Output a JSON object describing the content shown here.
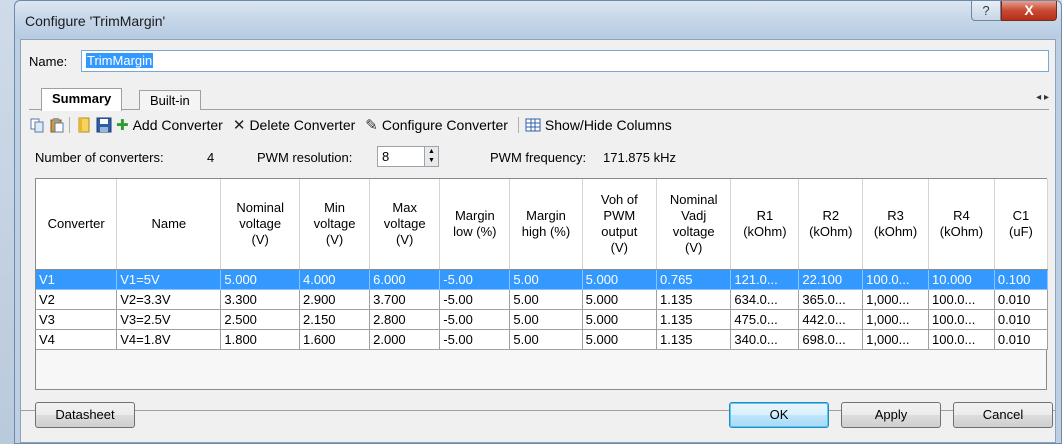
{
  "window": {
    "title": "Configure 'TrimMargin'",
    "help_glyph": "?",
    "close_glyph": "X"
  },
  "name_field": {
    "label": "Name:",
    "value": "TrimMargin"
  },
  "tabs": [
    {
      "label": "Summary",
      "active": true
    },
    {
      "label": "Built-in",
      "active": false
    }
  ],
  "tab_scroll": "◂ ▸",
  "toolbar": {
    "add_converter": "Add Converter",
    "delete_converter": "Delete Converter",
    "configure_converter": "Configure Converter",
    "show_hide_columns": "Show/Hide Columns"
  },
  "info": {
    "num_converters_label": "Number of converters:",
    "num_converters_value": "4",
    "pwm_resolution_label": "PWM resolution:",
    "pwm_resolution_value": "8",
    "pwm_frequency_label": "PWM frequency:",
    "pwm_frequency_value": "171.875 kHz"
  },
  "table": {
    "headers": [
      [
        "Converter"
      ],
      [
        "Name"
      ],
      [
        "Nominal",
        "voltage",
        "(V)"
      ],
      [
        "Min",
        "voltage",
        "(V)"
      ],
      [
        "Max",
        "voltage",
        "(V)"
      ],
      [
        "Margin",
        "low (%)"
      ],
      [
        "Margin",
        "high (%)"
      ],
      [
        "Voh of",
        "PWM",
        "output",
        "(V)"
      ],
      [
        "Nominal",
        "Vadj",
        "voltage",
        "(V)"
      ],
      [
        "R1",
        "(kOhm)"
      ],
      [
        "R2",
        "(kOhm)"
      ],
      [
        "R3",
        "(kOhm)"
      ],
      [
        "R4",
        "(kOhm)"
      ],
      [
        "C1",
        "(uF)"
      ]
    ],
    "rows": [
      [
        "V1",
        "V1=5V",
        "5.000",
        "4.000",
        "6.000",
        "-5.00",
        "5.00",
        "5.000",
        "0.765",
        "121.0...",
        "22.100",
        "100.0...",
        "10.000",
        "0.100"
      ],
      [
        "V2",
        "V2=3.3V",
        "3.300",
        "2.900",
        "3.700",
        "-5.00",
        "5.00",
        "5.000",
        "1.135",
        "634.0...",
        "365.0...",
        "1,000...",
        "100.0...",
        "0.010"
      ],
      [
        "V3",
        "V3=2.5V",
        "2.500",
        "2.150",
        "2.800",
        "-5.00",
        "5.00",
        "5.000",
        "1.135",
        "475.0...",
        "442.0...",
        "1,000...",
        "100.0...",
        "0.010"
      ],
      [
        "V4",
        "V4=1.8V",
        "1.800",
        "1.600",
        "2.000",
        "-5.00",
        "5.00",
        "5.000",
        "1.135",
        "340.0...",
        "698.0...",
        "1,000...",
        "100.0...",
        "0.010"
      ]
    ],
    "selected_row": 0
  },
  "buttons": {
    "datasheet": "Datasheet",
    "ok": "OK",
    "apply": "Apply",
    "cancel": "Cancel"
  },
  "colors": {
    "selection": "#3399ff",
    "close": "#c84a32"
  }
}
